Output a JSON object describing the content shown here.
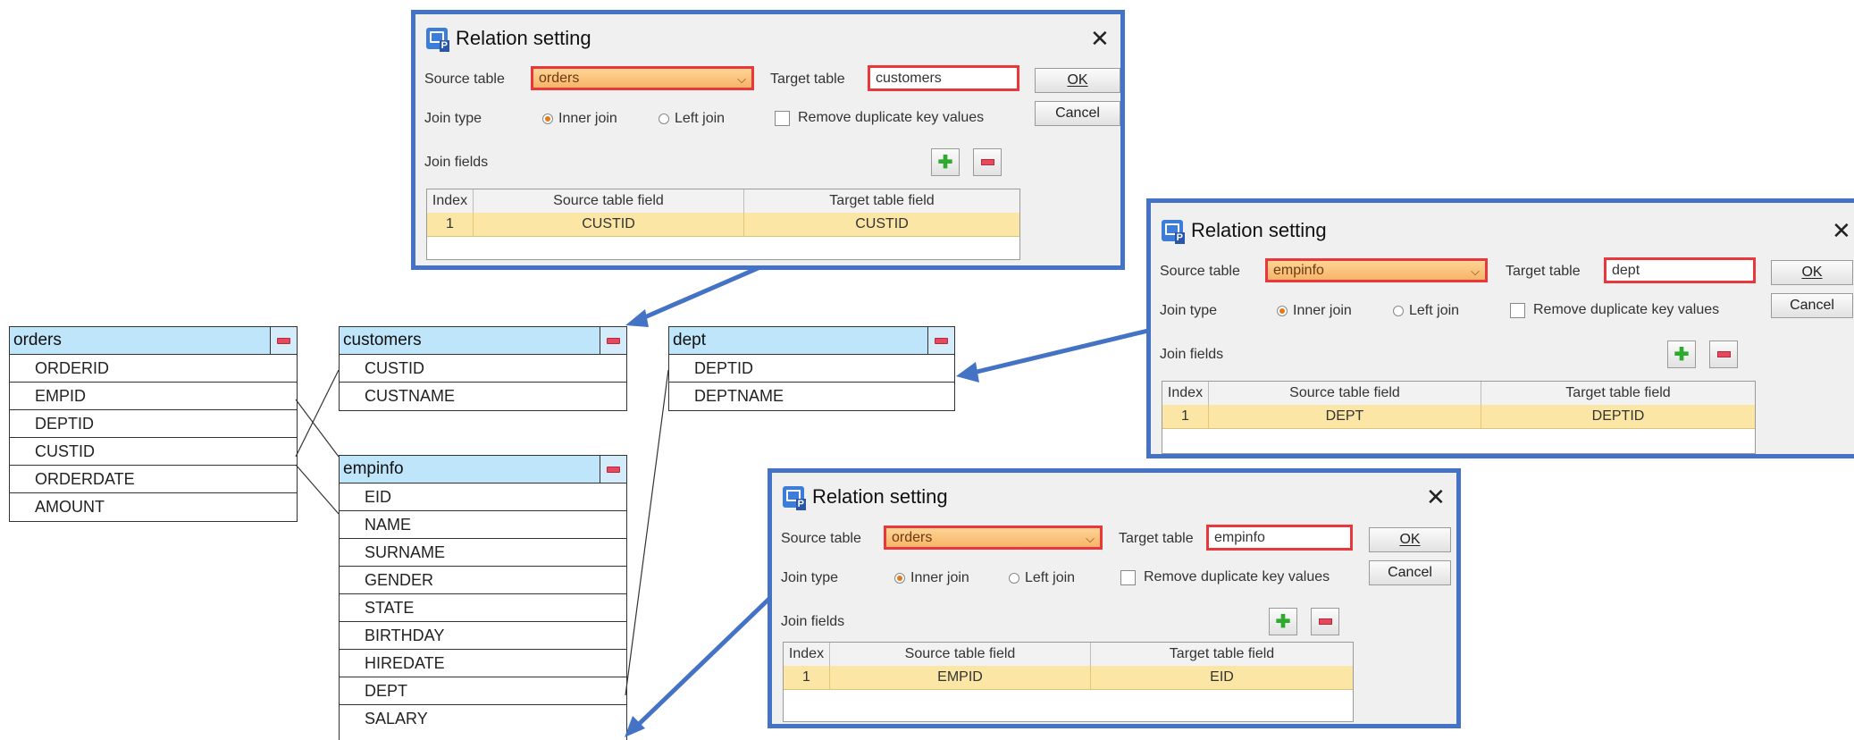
{
  "tables": {
    "orders": {
      "name": "orders",
      "fields": [
        "ORDERID",
        "EMPID",
        "DEPTID",
        "CUSTID",
        "ORDERDATE",
        "AMOUNT"
      ]
    },
    "customers": {
      "name": "customers",
      "fields": [
        "CUSTID",
        "CUSTNAME"
      ]
    },
    "dept": {
      "name": "dept",
      "fields": [
        "DEPTID",
        "DEPTNAME"
      ]
    },
    "empinfo": {
      "name": "empinfo",
      "fields": [
        "EID",
        "NAME",
        "SURNAME",
        "GENDER",
        "STATE",
        "BIRTHDAY",
        "HIREDATE",
        "DEPT",
        "SALARY"
      ]
    }
  },
  "common": {
    "title": "Relation setting",
    "source_label": "Source table",
    "target_label": "Target table",
    "join_type_label": "Join type",
    "inner_join": "Inner join",
    "left_join": "Left join",
    "remove_dup": "Remove duplicate key values",
    "join_fields_label": "Join fields",
    "ok": "OK",
    "cancel": "Cancel",
    "col_index": "Index",
    "col_source": "Source table field",
    "col_target": "Target table field",
    "close_icon": "close-icon",
    "add_icon": "plus-icon",
    "remove_icon": "minus-icon",
    "dropdown_icon": "chevron-down-icon"
  },
  "dialogs": [
    {
      "source": "orders",
      "target": "customers",
      "row": {
        "index": "1",
        "source_field": "CUSTID",
        "target_field": "CUSTID"
      }
    },
    {
      "source": "empinfo",
      "target": "dept",
      "row": {
        "index": "1",
        "source_field": "DEPT",
        "target_field": "DEPTID"
      }
    },
    {
      "source": "orders",
      "target": "empinfo",
      "row": {
        "index": "1",
        "source_field": "EMPID",
        "target_field": "EID"
      }
    }
  ],
  "colors": {
    "dialog_border": "#4472c4",
    "highlight_border": "#e8383c",
    "table_header": "#bfe5fa",
    "selected_row": "#fbe6a6"
  }
}
